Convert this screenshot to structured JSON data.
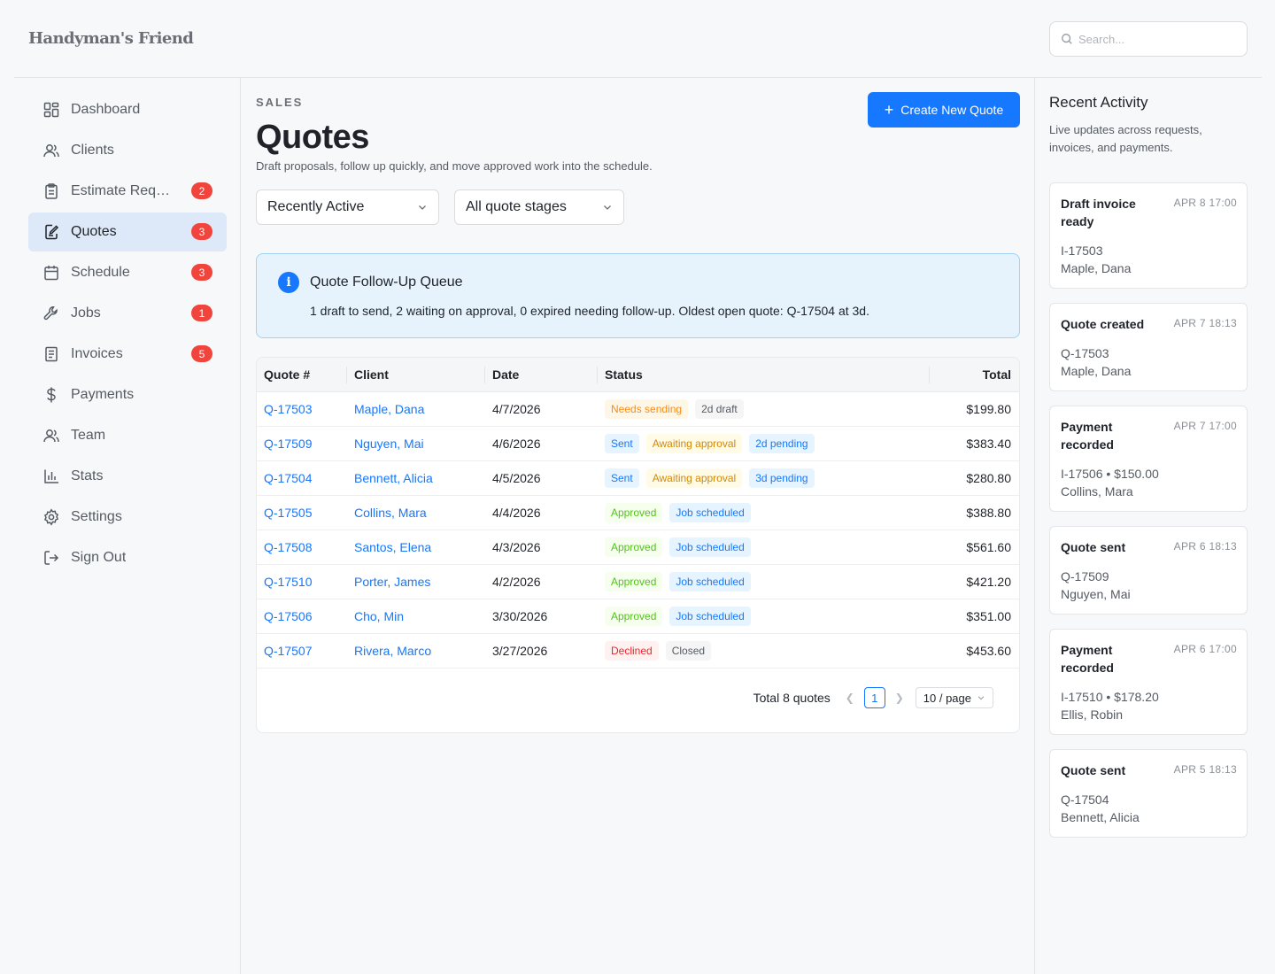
{
  "app": {
    "logo": "Handyman's Friend"
  },
  "search": {
    "placeholder": "Search..."
  },
  "sidebar": {
    "items": [
      {
        "label": "Dashboard",
        "icon": "dashboard-icon",
        "badge": ""
      },
      {
        "label": "Clients",
        "icon": "users-icon",
        "badge": ""
      },
      {
        "label": "Estimate Requests",
        "icon": "clipboard-icon",
        "badge": "2"
      },
      {
        "label": "Quotes",
        "icon": "edit-doc-icon",
        "badge": "3",
        "active": true
      },
      {
        "label": "Schedule",
        "icon": "calendar-icon",
        "badge": "3"
      },
      {
        "label": "Jobs",
        "icon": "wrench-icon",
        "badge": "1"
      },
      {
        "label": "Invoices",
        "icon": "invoice-icon",
        "badge": "5"
      },
      {
        "label": "Payments",
        "icon": "dollar-icon",
        "badge": ""
      },
      {
        "label": "Team",
        "icon": "team-icon",
        "badge": ""
      },
      {
        "label": "Stats",
        "icon": "bar-chart-icon",
        "badge": ""
      },
      {
        "label": "Settings",
        "icon": "gear-icon",
        "badge": ""
      },
      {
        "label": "Sign Out",
        "icon": "sign-out-icon",
        "badge": ""
      }
    ]
  },
  "main": {
    "section": "SALES",
    "title": "Quotes",
    "subtitle": "Draft proposals, follow up quickly, and move approved work into the schedule.",
    "create_button": "Create New Quote",
    "filters": {
      "sort": "Recently Active",
      "stage": "All quote stages"
    },
    "alert": {
      "title": "Quote Follow-Up Queue",
      "text": "1 draft to send, 2 waiting on approval, 0 expired needing follow-up. Oldest open quote: Q-17504 at 3d."
    },
    "table": {
      "columns": [
        "Quote #",
        "Client",
        "Date",
        "Status",
        "Total"
      ],
      "rows": [
        {
          "quote": "Q-17503",
          "client": "Maple, Dana",
          "date": "4/7/2026",
          "tags": [
            {
              "text": "Needs sending",
              "kind": "orange"
            },
            {
              "text": "2d draft",
              "kind": "gray"
            }
          ],
          "total": "$199.80"
        },
        {
          "quote": "Q-17509",
          "client": "Nguyen, Mai",
          "date": "4/6/2026",
          "tags": [
            {
              "text": "Sent",
              "kind": "blue"
            },
            {
              "text": "Awaiting approval",
              "kind": "gold"
            },
            {
              "text": "2d pending",
              "kind": "blue"
            }
          ],
          "total": "$383.40"
        },
        {
          "quote": "Q-17504",
          "client": "Bennett, Alicia",
          "date": "4/5/2026",
          "tags": [
            {
              "text": "Sent",
              "kind": "blue"
            },
            {
              "text": "Awaiting approval",
              "kind": "gold"
            },
            {
              "text": "3d pending",
              "kind": "blue"
            }
          ],
          "total": "$280.80"
        },
        {
          "quote": "Q-17505",
          "client": "Collins, Mara",
          "date": "4/4/2026",
          "tags": [
            {
              "text": "Approved",
              "kind": "green"
            },
            {
              "text": "Job scheduled",
              "kind": "blue"
            }
          ],
          "total": "$388.80"
        },
        {
          "quote": "Q-17508",
          "client": "Santos, Elena",
          "date": "4/3/2026",
          "tags": [
            {
              "text": "Approved",
              "kind": "green"
            },
            {
              "text": "Job scheduled",
              "kind": "blue"
            }
          ],
          "total": "$561.60"
        },
        {
          "quote": "Q-17510",
          "client": "Porter, James",
          "date": "4/2/2026",
          "tags": [
            {
              "text": "Approved",
              "kind": "green"
            },
            {
              "text": "Job scheduled",
              "kind": "blue"
            }
          ],
          "total": "$421.20"
        },
        {
          "quote": "Q-17506",
          "client": "Cho, Min",
          "date": "3/30/2026",
          "tags": [
            {
              "text": "Approved",
              "kind": "green"
            },
            {
              "text": "Job scheduled",
              "kind": "blue"
            }
          ],
          "total": "$351.00"
        },
        {
          "quote": "Q-17507",
          "client": "Rivera, Marco",
          "date": "3/27/2026",
          "tags": [
            {
              "text": "Declined",
              "kind": "red"
            },
            {
              "text": "Closed",
              "kind": "gray"
            }
          ],
          "total": "$453.60"
        }
      ]
    },
    "pagination": {
      "total": "Total 8 quotes",
      "page": "1",
      "page_size": "10 / page"
    }
  },
  "activity": {
    "title": "Recent Activity",
    "subtitle": "Live updates across requests, invoices, and payments.",
    "items": [
      {
        "title": "Draft invoice ready",
        "time": "APR 8 17:00",
        "line1": "I-17503",
        "line2": "Maple, Dana"
      },
      {
        "title": "Quote created",
        "time": "APR 7 18:13",
        "line1": "Q-17503",
        "line2": "Maple, Dana"
      },
      {
        "title": "Payment recorded",
        "time": "APR 7 17:00",
        "line1": "I-17506 • $150.00",
        "line2": "Collins, Mara"
      },
      {
        "title": "Quote sent",
        "time": "APR 6 18:13",
        "line1": "Q-17509",
        "line2": "Nguyen, Mai"
      },
      {
        "title": "Payment recorded",
        "time": "APR 6 17:00",
        "line1": "I-17510 • $178.20",
        "line2": "Ellis, Robin"
      },
      {
        "title": "Quote sent",
        "time": "APR 5 18:13",
        "line1": "Q-17504",
        "line2": "Bennett, Alicia"
      }
    ]
  },
  "colors": {
    "primary": "#1677ff",
    "badge": "#f0443c",
    "active_nav_bg": "#dde9f8",
    "tag_orange": "#fa8c16",
    "tag_gold": "#d48806",
    "tag_green": "#52c41a",
    "tag_red": "#f5222d"
  }
}
